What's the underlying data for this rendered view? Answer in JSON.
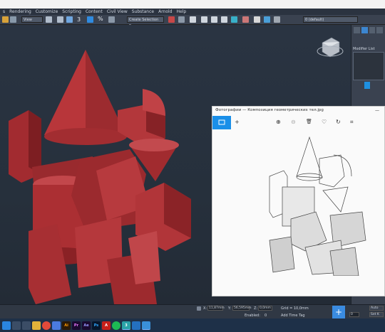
{
  "menu": [
    "s",
    "Rendering",
    "Customize",
    "Scripting",
    "Content",
    "Civil View",
    "Substance",
    "Arnold",
    "Help"
  ],
  "toolbar": {
    "view_combo": "View",
    "selection_set_combo": "Create Selection Se",
    "layer_combo": "0 (default)",
    "number_3": "3",
    "percent": "%"
  },
  "right_panel": {
    "modifier_list_label": "Modifier List"
  },
  "photos": {
    "title": "Фотографии — Композиция геометрических тел.jpg",
    "minimize": "—",
    "maximize": "□",
    "add": "+",
    "zoom_in": "⊕",
    "zoom_out": "⊖",
    "delete": "🗑",
    "favorite": "♡",
    "rotate": "↻",
    "crop": "⌗"
  },
  "status": {
    "x_label": "X:",
    "x_value": "11,87mm",
    "y_label": "Y:",
    "y_value": "56,595mm",
    "z_label": "Z:",
    "z_value": "0,0mm",
    "grid": "Grid = 10,0mm",
    "enabled": "Enabled:",
    "enabled_value": "0",
    "add_time_tag": "Add Time Tag",
    "auto": "Auto",
    "set_k": "Set K",
    "frame": "0"
  },
  "taskbar": {
    "apps": [
      "windows",
      "search",
      "taskview",
      "explorer",
      "chrome",
      "store",
      "illustrator",
      "premiere",
      "aftereffects",
      "photoshop",
      "acrobat",
      "spotify",
      "3dsmax",
      "vscode",
      "photos"
    ],
    "labels": [
      "",
      "",
      "",
      "",
      "",
      "",
      "Ai",
      "Pr",
      "Ae",
      "Ps",
      "A",
      "",
      "3",
      "",
      ""
    ]
  },
  "colors": {
    "accent_blue": "#1a8fe8",
    "object_red": "#b8363a",
    "viewport_bg": "#262f3b"
  }
}
